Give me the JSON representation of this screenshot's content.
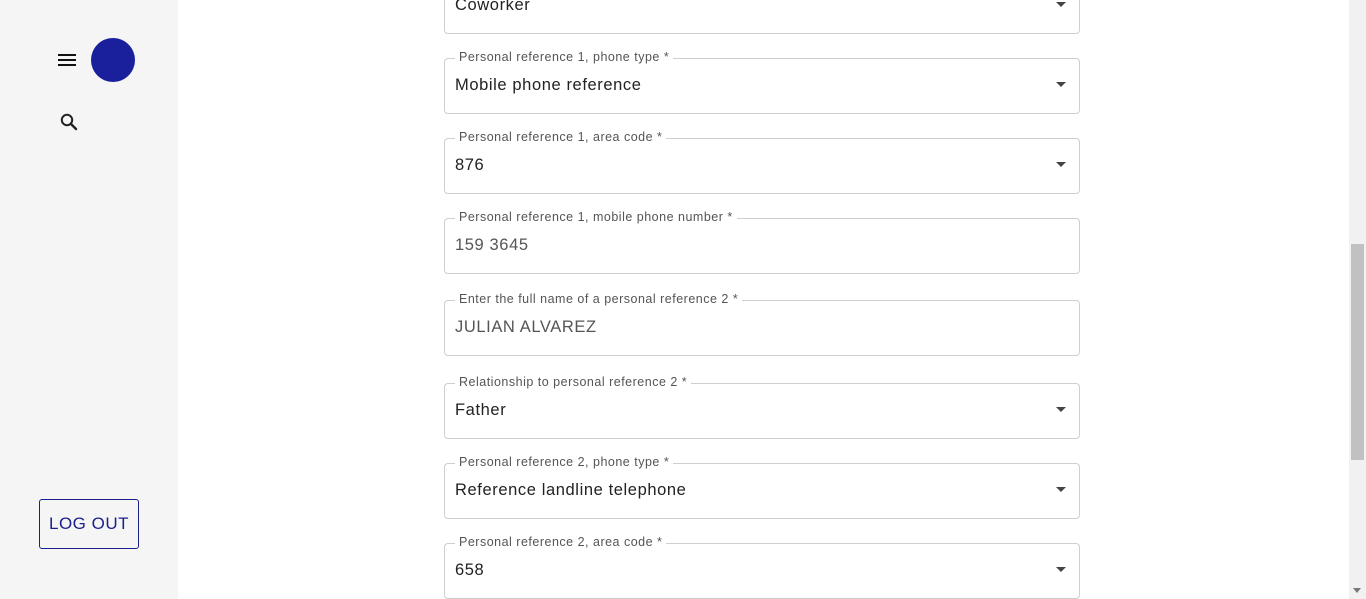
{
  "sidebar": {
    "logout_label": "LOG OUT",
    "menu_icon": "hamburger-menu-icon",
    "search_icon": "search-icon",
    "avatar_color": "#1a1f9c"
  },
  "form": {
    "fields": [
      {
        "label": "",
        "value": "Coworker",
        "kind": "select"
      },
      {
        "label": "Personal reference 1, phone type *",
        "value": "Mobile phone reference",
        "kind": "select"
      },
      {
        "label": "Personal reference 1, area code *",
        "value": "876",
        "kind": "select"
      },
      {
        "label": "Personal reference 1, mobile phone number *",
        "value": "159 3645",
        "kind": "input"
      },
      {
        "label": "Enter the full name of a personal reference 2 *",
        "value": "JULIAN ALVAREZ",
        "kind": "input"
      },
      {
        "label": "Relationship to personal reference 2 *",
        "value": "Father",
        "kind": "select"
      },
      {
        "label": "Personal reference 2, phone type *",
        "value": "Reference landline telephone",
        "kind": "select"
      },
      {
        "label": "Personal reference 2, area code *",
        "value": "658",
        "kind": "select"
      }
    ]
  }
}
